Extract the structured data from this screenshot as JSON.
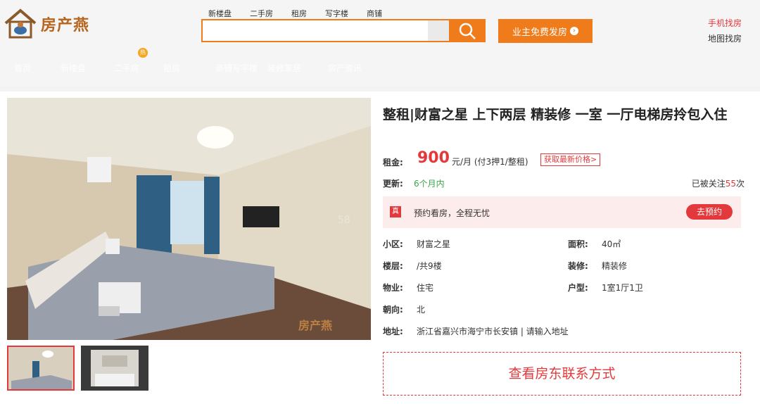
{
  "brand": {
    "name": "房产燕"
  },
  "search": {
    "tabs": [
      "新楼盘",
      "二手房",
      "租房",
      "写字楼",
      "商铺"
    ],
    "value": "",
    "placeholder": ""
  },
  "header": {
    "publish_label": "业主免费发房",
    "mobile_link": "手机找房",
    "map_link": "地图找房"
  },
  "nav": {
    "items": [
      "首页",
      "新楼盘",
      "二手房",
      "租房",
      "商铺写字楼",
      "装修家居",
      "房产资讯"
    ],
    "badge": "热"
  },
  "listing": {
    "title": "整租|财富之星 上下两层 精装修 一室 一厅电梯房拎包入住",
    "rent_label": "租金:",
    "rent_value": "900",
    "rent_unit": "元/月 (付3押1/整租)",
    "price_button": "获取最新价格>",
    "update_label": "更新:",
    "update_value": "6个月内",
    "follow_prefix": "已被关注",
    "follow_count": "55",
    "follow_suffix": "次",
    "appoint_tag": "真",
    "appoint_text": "预约看房，全程无忧",
    "appoint_button": "去预约",
    "info": {
      "community_label": "小区:",
      "community": "财富之星",
      "area_label": "面积:",
      "area": "40㎡",
      "floor_label": "楼层:",
      "floor": "/共9楼",
      "decor_label": "装修:",
      "decor": "精装修",
      "type_label": "物业:",
      "type": "住宅",
      "layout_label": "户型:",
      "layout": "1室1厅1卫",
      "orient_label": "朝向:",
      "orient": "北",
      "address_label": "地址:",
      "address": "浙江省嘉兴市海宁市长安镇 | 请输入地址"
    },
    "contact_button": "查看房东联系方式",
    "photo_watermark": "房产燕"
  },
  "colors": {
    "accent": "#f07b1a",
    "red": "#e4393c",
    "green": "#3aa64a"
  },
  "icons": [
    "house-logo-icon",
    "search-icon",
    "arrow-circle-icon"
  ]
}
